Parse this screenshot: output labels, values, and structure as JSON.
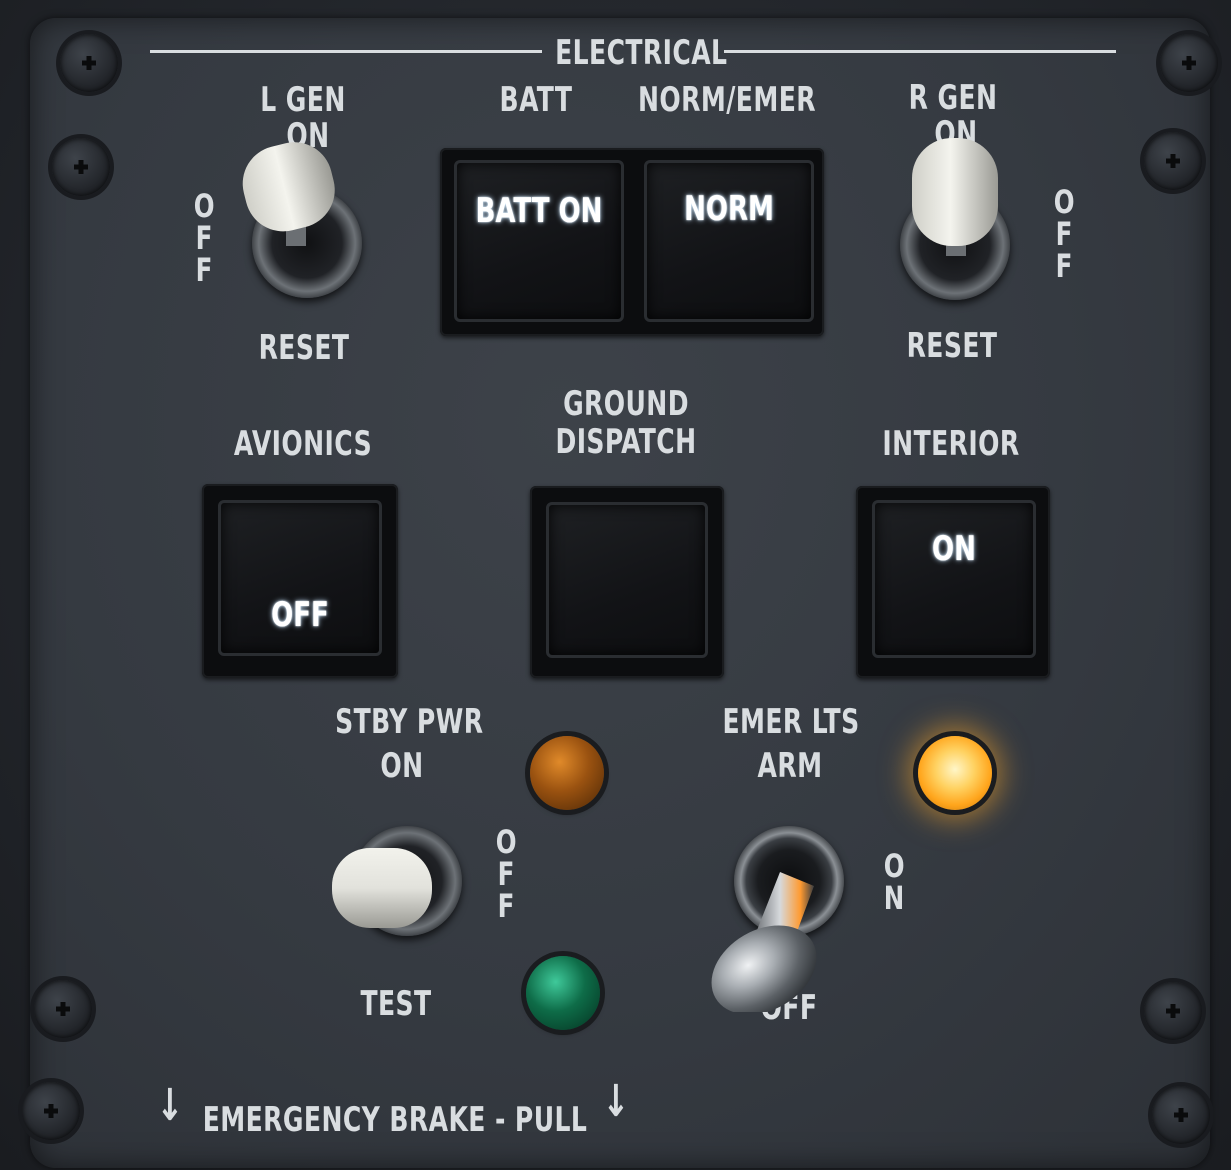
{
  "panel": {
    "title": "ELECTRICAL",
    "footer": "EMERGENCY BRAKE - PULL",
    "footer_arrows": "↓"
  },
  "l_gen": {
    "label": "L GEN",
    "on": "ON",
    "off": "OFF",
    "reset": "RESET",
    "state": "ON"
  },
  "r_gen": {
    "label": "R GEN",
    "on": "ON",
    "off": "OFF",
    "reset": "RESET",
    "state": "ON"
  },
  "batt": {
    "label": "BATT",
    "display": "BATT ON"
  },
  "norm_emer": {
    "label": "NORM/EMER",
    "display": "NORM"
  },
  "avionics": {
    "label": "AVIONICS",
    "display": "OFF"
  },
  "ground_dispatch": {
    "label_line1": "GROUND",
    "label_line2": "DISPATCH",
    "display": ""
  },
  "interior": {
    "label": "INTERIOR",
    "display": "ON"
  },
  "stby_pwr": {
    "label": "STBY PWR",
    "on": "ON",
    "off": "OFF",
    "test": "TEST",
    "state": "ON"
  },
  "emer_lts": {
    "label": "EMER LTS",
    "arm": "ARM",
    "on": "ON",
    "off": "OFF",
    "state": "OFF"
  },
  "lamps": {
    "stby_amber": {
      "color": "#b5640f",
      "lit": false
    },
    "stby_green": {
      "color": "#0f7a52",
      "lit": false
    },
    "emer_amber": {
      "color": "#ffb020",
      "lit": true
    }
  }
}
